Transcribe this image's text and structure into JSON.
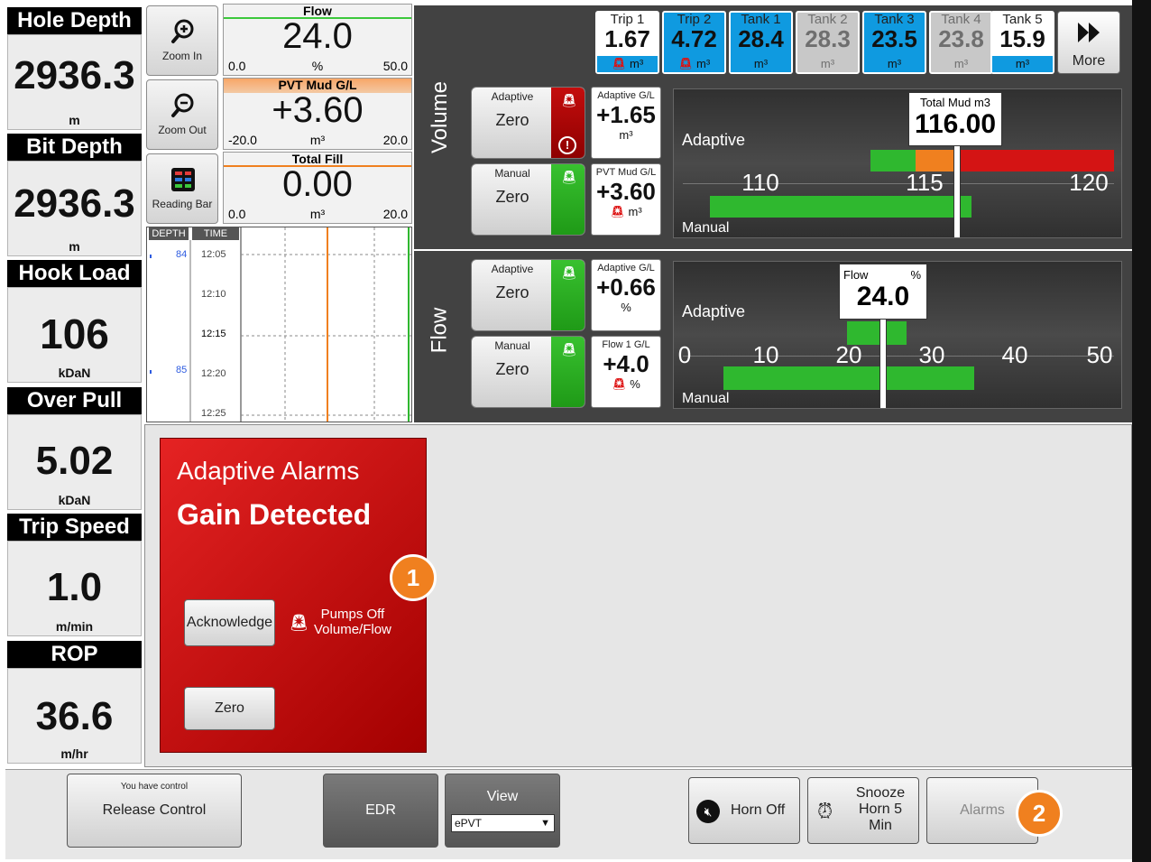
{
  "metrics": [
    {
      "title": "Hole Depth",
      "value": "2936.3",
      "unit": "m"
    },
    {
      "title": "Bit Depth",
      "value": "2936.3",
      "unit": "m"
    },
    {
      "title": "Hook Load",
      "value": "106",
      "unit": "kDaN"
    },
    {
      "title": "Over Pull",
      "value": "5.02",
      "unit": "kDaN"
    },
    {
      "title": "Trip Speed",
      "value": "1.0",
      "unit": "m/min"
    },
    {
      "title": "ROP",
      "value": "36.6",
      "unit": "m/hr"
    }
  ],
  "tools": {
    "zoom_in": "Zoom In",
    "zoom_out": "Zoom Out",
    "reading_bar": "Reading Bar"
  },
  "gauges": [
    {
      "title": "Flow",
      "value": "24.0",
      "min": "0.0",
      "max": "50.0",
      "unit": "%",
      "accent": "#3cc83c"
    },
    {
      "title": "PVT Mud G/L",
      "value": "+3.60",
      "min": "-20.0",
      "max": "20.0",
      "unit": "m³",
      "accent": "#f0801f"
    },
    {
      "title": "Total Fill",
      "value": "0.00",
      "min": "0.0",
      "max": "20.0",
      "unit": "m³",
      "accent": "#f0801f"
    }
  ],
  "trend": {
    "depth_header": "DEPTH",
    "time_header": "TIME",
    "depth_labels": [
      "84",
      "85"
    ],
    "time_labels": [
      "12:05",
      "12:10",
      "12:15",
      "12:20",
      "12:25"
    ]
  },
  "tanks": [
    {
      "name": "Trip 1",
      "value": "1.67",
      "unit": "m³",
      "style": "whiteunit",
      "alarm": true
    },
    {
      "name": "Trip 2",
      "value": "4.72",
      "unit": "m³",
      "style": "blue",
      "alarm": true
    },
    {
      "name": "Tank 1",
      "value": "28.4",
      "unit": "m³",
      "style": "blue",
      "alarm": false
    },
    {
      "name": "Tank 2",
      "value": "28.3",
      "unit": "m³",
      "style": "gray",
      "alarm": false
    },
    {
      "name": "Tank 3",
      "value": "23.5",
      "unit": "m³",
      "style": "blue",
      "alarm": false
    },
    {
      "name": "Tank 4",
      "value": "23.8",
      "unit": "m³",
      "style": "gray",
      "alarm": false
    },
    {
      "name": "Tank 5",
      "value": "15.9",
      "unit": "m³",
      "style": "whiteunit",
      "alarm": false
    }
  ],
  "more_label": "More",
  "volume": {
    "title": "Volume",
    "adaptive_btn": {
      "title": "Adaptive",
      "label": "Zero"
    },
    "manual_btn": {
      "title": "Manual",
      "label": "Zero"
    },
    "adaptive_gl": {
      "title": "Adaptive G/L",
      "value": "+1.65",
      "unit": "m³"
    },
    "pvt_gl": {
      "title": "PVT Mud G/L",
      "value": "+3.60",
      "unit": "m³"
    },
    "scale_adaptive": "Adaptive",
    "scale_manual": "Manual",
    "ticks": [
      "110",
      "115",
      "120"
    ],
    "readout_title": "Total Mud",
    "readout_unit": "m3",
    "readout_value": "116.00"
  },
  "flow": {
    "title": "Flow",
    "adaptive_btn": {
      "title": "Adaptive",
      "label": "Zero"
    },
    "manual_btn": {
      "title": "Manual",
      "label": "Zero"
    },
    "adaptive_gl": {
      "title": "Adaptive G/L",
      "value": "+0.66",
      "unit": "%"
    },
    "flow1_gl": {
      "title": "Flow 1 G/L",
      "value": "+4.0",
      "unit": "%"
    },
    "scale_adaptive": "Adaptive",
    "scale_manual": "Manual",
    "ticks": [
      "0",
      "10",
      "20",
      "30",
      "40",
      "50"
    ],
    "readout_title": "Flow",
    "readout_unit": "%",
    "readout_value": "24.0"
  },
  "alarm": {
    "title": "Adaptive Alarms",
    "subtitle": "Gain Detected",
    "acknowledge": "Acknowledge",
    "zero": "Zero",
    "status_line1": "Pumps Off",
    "status_line2": "Volume/Flow",
    "badge": "1"
  },
  "bottom": {
    "control_caption": "You have control",
    "release_control": "Release Control",
    "edr": "EDR",
    "view_label": "View",
    "view_value": "ePVT",
    "horn_off": "Horn Off",
    "snooze": "Snooze Horn 5 Min",
    "alarms": "Alarms",
    "badge": "2"
  },
  "colors": {
    "alarm_red": "#d41414",
    "tank_blue": "#0f9ae0",
    "green": "#2fb82f",
    "orange": "#f0801f"
  }
}
